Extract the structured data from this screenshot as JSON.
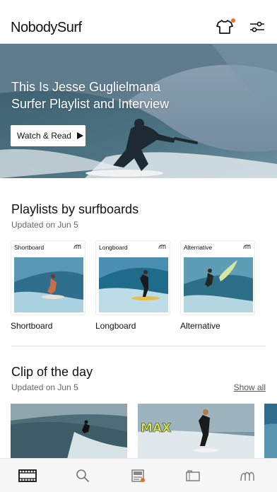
{
  "app": {
    "logo": "NobodySurf"
  },
  "header": {
    "shirt_icon": "tshirt-icon",
    "filter_icon": "sliders-icon",
    "accent": "#f06a28"
  },
  "hero": {
    "title": "This Is Jesse Guglielmana",
    "subtitle": "Surfer Playlist and Interview",
    "button_label": "Watch & Read"
  },
  "playlists": {
    "title": "Playlists by surfboards",
    "updated": "Updated on Jun 5",
    "items": [
      {
        "card_label": "Shortboard",
        "name": "Shortboard"
      },
      {
        "card_label": "Longboard",
        "name": "Longboard"
      },
      {
        "card_label": "Alternative",
        "name": "Alternative"
      }
    ]
  },
  "clip_of_day": {
    "title": "Clip of the day",
    "updated": "Updated on Jun 5",
    "show_all": "Show all",
    "banner_text": "MAX"
  },
  "tabbar": {
    "items": [
      {
        "icon": "film-icon",
        "active": true
      },
      {
        "icon": "search-icon",
        "active": false
      },
      {
        "icon": "article-icon",
        "active": false,
        "badge": true
      },
      {
        "icon": "folder-icon",
        "active": false
      },
      {
        "icon": "logo-waves-icon",
        "active": false
      }
    ]
  }
}
